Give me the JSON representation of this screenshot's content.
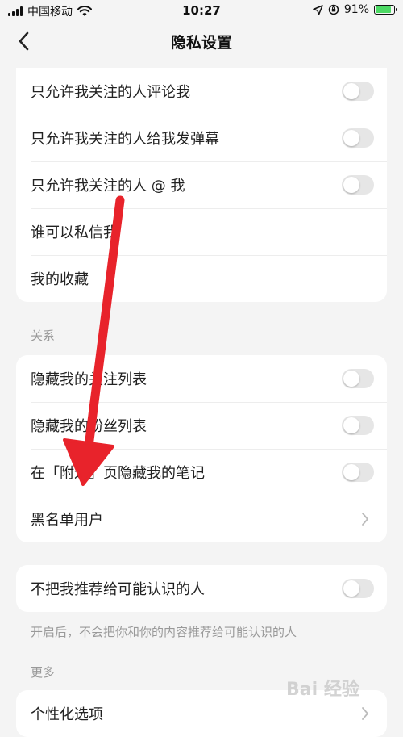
{
  "status_bar": {
    "carrier": "中国移动",
    "time": "10:27",
    "battery": "91%",
    "battery_level": 0.91
  },
  "nav": {
    "title": "隐私设置"
  },
  "section1": {
    "items": [
      {
        "label": "只允许我关注的人评论我",
        "control": "toggle",
        "on": false
      },
      {
        "label": "只允许我关注的人给我发弹幕",
        "control": "toggle",
        "on": false
      },
      {
        "label": "只允许我关注的人 @ 我",
        "control": "toggle",
        "on": false
      },
      {
        "label": "谁可以私信我",
        "control": "none"
      },
      {
        "label": "我的收藏",
        "control": "none"
      }
    ]
  },
  "section2": {
    "title": "关系",
    "items": [
      {
        "label": "隐藏我的关注列表",
        "control": "toggle",
        "on": false
      },
      {
        "label": "隐藏我的粉丝列表",
        "control": "toggle",
        "on": false
      },
      {
        "label": "在「附近」页隐藏我的笔记",
        "control": "toggle",
        "on": false
      },
      {
        "label": "黑名单用户",
        "control": "chevron"
      }
    ]
  },
  "section3": {
    "items": [
      {
        "label": "不把我推荐给可能认识的人",
        "control": "toggle",
        "on": false
      }
    ],
    "hint": "开启后，不会把你和你的内容推荐给可能认识的人"
  },
  "section4": {
    "title": "更多",
    "items": [
      {
        "label": "个性化选项",
        "control": "chevron"
      }
    ]
  },
  "watermark": {
    "text": "Bai 经验"
  },
  "colors": {
    "annotation_arrow": "#e8232b",
    "toggle_off": "#e6e6e6",
    "background": "#f4f4f4"
  }
}
